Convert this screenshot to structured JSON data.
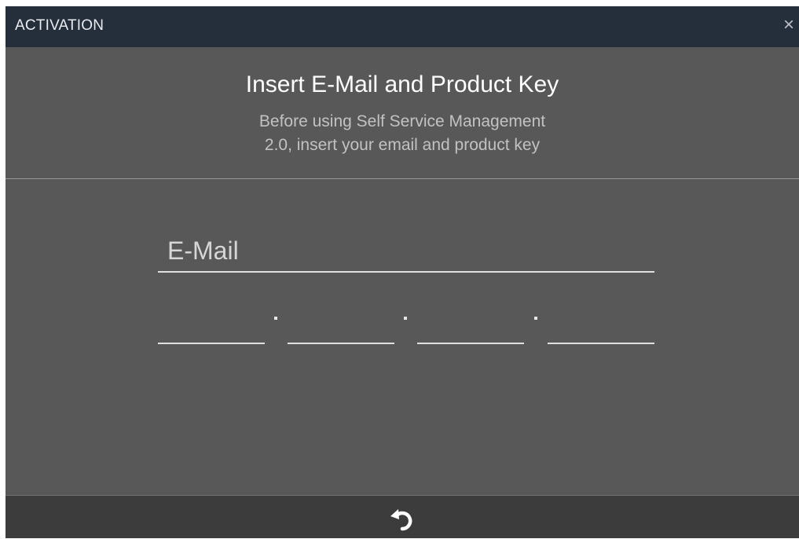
{
  "window": {
    "title": "ACTIVATION",
    "close_glyph": "×"
  },
  "header": {
    "heading": "Insert E-Mail and Product Key",
    "subheading_line1": "Before using Self Service Management",
    "subheading_line2": "2.0, insert your email and product key"
  },
  "form": {
    "email": {
      "placeholder": "E-Mail",
      "value": ""
    },
    "product_key": {
      "segments": [
        "",
        "",
        "",
        ""
      ],
      "separator": "."
    }
  },
  "footer": {
    "undo_icon": "undo-icon"
  },
  "colors": {
    "titlebar": "#252e3b",
    "body": "#585858",
    "footer": "#3c3c3c",
    "text_primary": "#ffffff",
    "text_secondary": "#c2c2c2"
  }
}
